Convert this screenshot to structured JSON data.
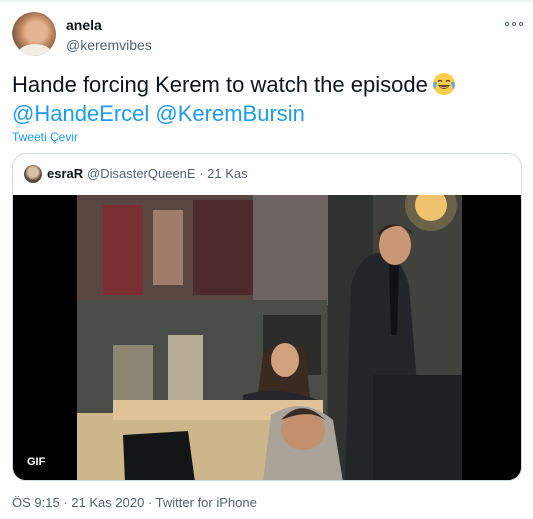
{
  "tweet": {
    "author": {
      "display_name": "anela",
      "handle": "@keremvibes"
    },
    "text": "Hande forcing Kerem to watch the episode",
    "emoji_icon": "face-with-tears-of-joy-icon",
    "mentions": [
      "@HandeErcel",
      "@KeremBursin"
    ],
    "translate_label": "Tweeti Çevir",
    "more_icon": "more-options-icon",
    "link_color": "#1d9bf0"
  },
  "quoted": {
    "author_name": "esraR",
    "author_handle": "@DisasterQueenE",
    "separator": "·",
    "date": "21 Kas",
    "media": {
      "kind": "animated-gif-thumbnail",
      "badge": "GIF"
    }
  },
  "footer": {
    "time": "ÖS 9:15",
    "separator_1": "·",
    "date": "21 Kas 2020",
    "separator_2": "·",
    "app": "Twitter for iPhone"
  }
}
